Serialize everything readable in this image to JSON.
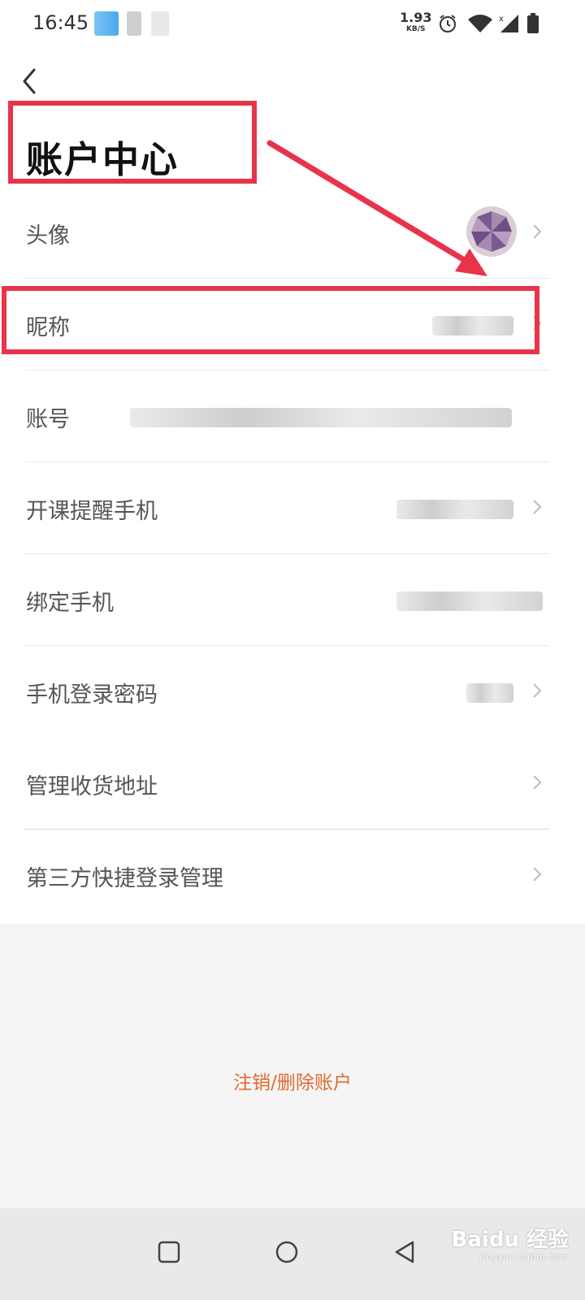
{
  "status_bar": {
    "time": "16:45",
    "net_speed_value": "1.93",
    "net_speed_unit": "KB/S",
    "icons": [
      "alarm-icon",
      "wifi-icon",
      "signal-icon",
      "battery-icon"
    ]
  },
  "header": {
    "back_icon": "chevron-left-icon",
    "title": "账户中心"
  },
  "settings": {
    "rows": [
      {
        "label": "头像"
      },
      {
        "label": "昵称"
      },
      {
        "label": "账号"
      },
      {
        "label": "开课提醒手机"
      },
      {
        "label": "绑定手机"
      },
      {
        "label": "手机登录密码"
      },
      {
        "label": "管理收货地址"
      },
      {
        "label": "第三方快捷登录管理"
      }
    ]
  },
  "footer": {
    "delete_account_label": "注销/删除账户"
  },
  "nav_bar": {
    "icons": [
      "recent-apps-icon",
      "home-icon",
      "back-icon"
    ]
  },
  "watermark": {
    "text": "Baidu 经验",
    "url": "jingyan.baidu.com"
  },
  "colors": {
    "annotation": "#e8334a",
    "accent_link": "#e06a2f"
  }
}
